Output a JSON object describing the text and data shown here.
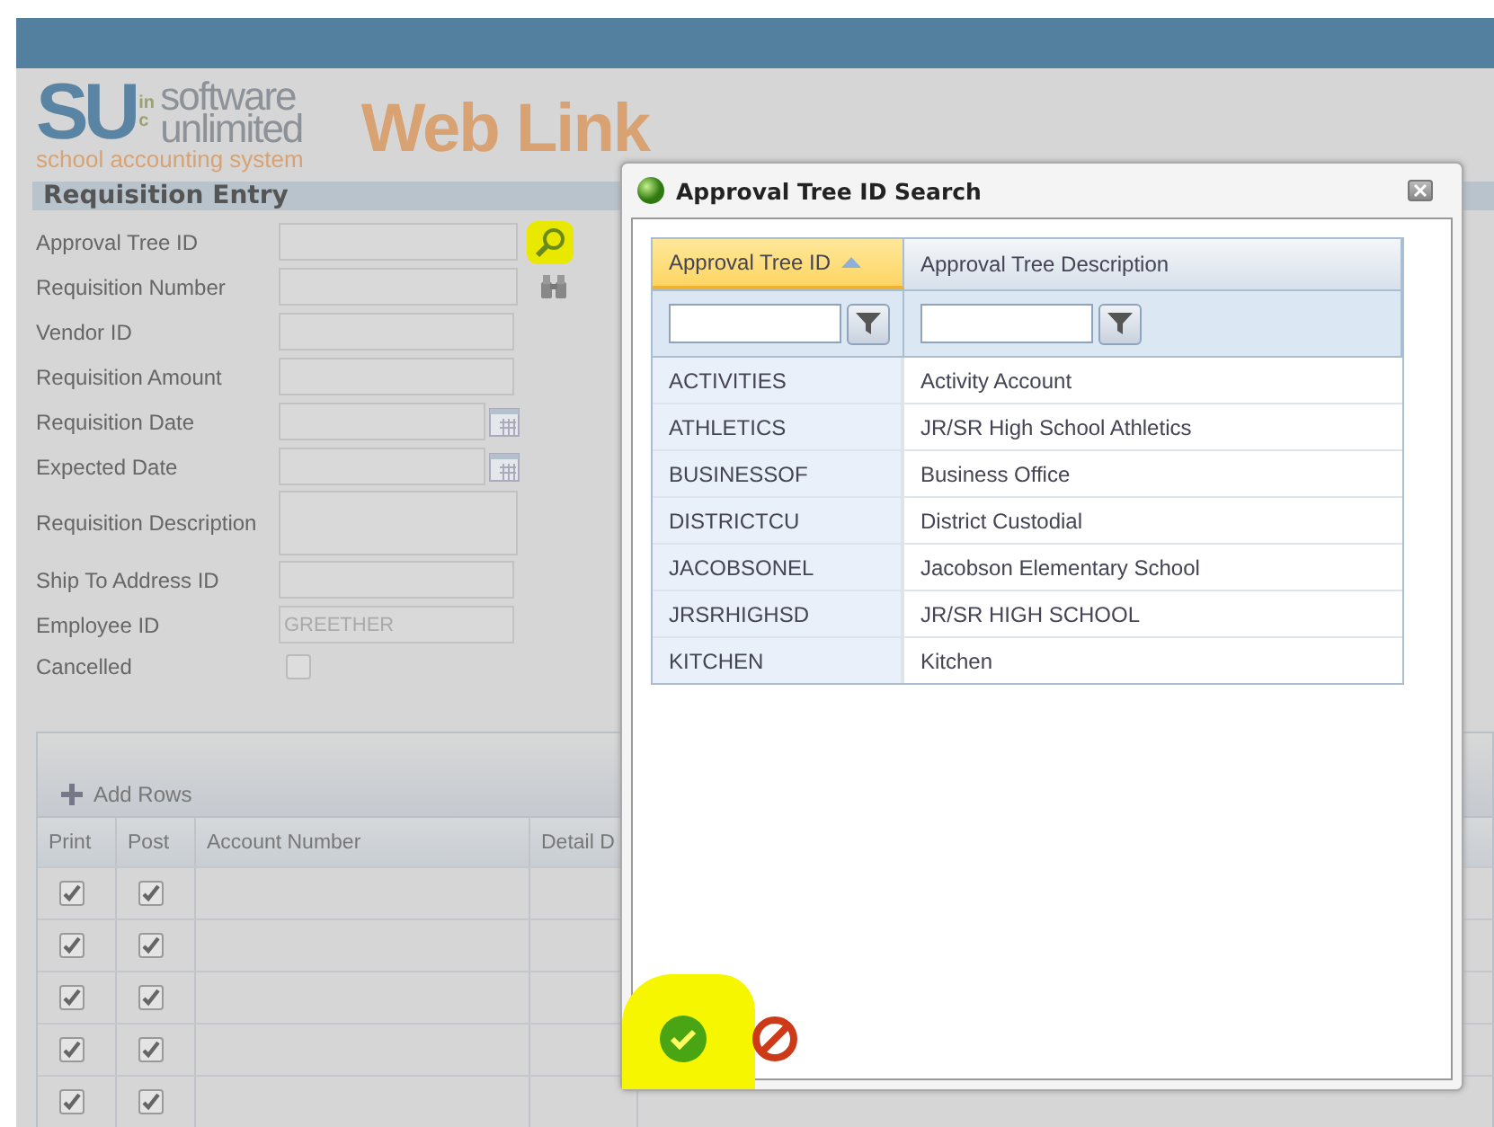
{
  "header": {
    "logo_letters": "SU",
    "logo_inc": "inc",
    "logo_line1": "software",
    "logo_line2": "unlimited",
    "logo_tagline": "school accounting system",
    "app_title": "Web Link"
  },
  "section_title": "Requisition Entry",
  "form_fields": [
    {
      "label": "Approval Tree ID",
      "kind": "lookup",
      "highlighted": true
    },
    {
      "label": "Requisition Number",
      "kind": "binoculars"
    },
    {
      "label": "Vendor ID",
      "kind": "text"
    },
    {
      "label": "Requisition Amount",
      "kind": "text"
    },
    {
      "label": "Requisition Date",
      "kind": "date"
    },
    {
      "label": "Expected Date",
      "kind": "date"
    },
    {
      "label": "Requisition Description",
      "kind": "textarea"
    },
    {
      "label": "Ship To Address ID",
      "kind": "text"
    },
    {
      "label": "Employee ID",
      "kind": "text",
      "value": "GREETHER"
    },
    {
      "label": "Cancelled",
      "kind": "checkbox",
      "checked": false
    }
  ],
  "lines": {
    "add_rows": "Add Rows",
    "columns": [
      "Print",
      "Post",
      "Account Number",
      "Detail D"
    ],
    "rows": [
      {
        "print": true,
        "post": true
      },
      {
        "print": true,
        "post": true
      },
      {
        "print": true,
        "post": true
      },
      {
        "print": true,
        "post": true
      },
      {
        "print": true,
        "post": true
      }
    ]
  },
  "dialog": {
    "title": "Approval Tree ID Search",
    "columns": [
      {
        "label": "Approval Tree ID",
        "sort_ascending": true,
        "selected": true
      },
      {
        "label": "Approval Tree Description",
        "sort_ascending": false,
        "selected": false
      }
    ],
    "rows": [
      {
        "id": "ACTIVITIES",
        "description": "Activity Account"
      },
      {
        "id": "ATHLETICS",
        "description": "JR/SR High School Athletics"
      },
      {
        "id": "BUSINESSOF",
        "description": "Business Office"
      },
      {
        "id": "DISTRICTCU",
        "description": "District Custodial"
      },
      {
        "id": "JACOBSONEL",
        "description": "Jacobson Elementary School"
      },
      {
        "id": "JRSRHIGHSD",
        "description": "JR/SR HIGH SCHOOL"
      },
      {
        "id": "KITCHEN",
        "description": "Kitchen"
      }
    ],
    "ok_highlighted": true
  }
}
